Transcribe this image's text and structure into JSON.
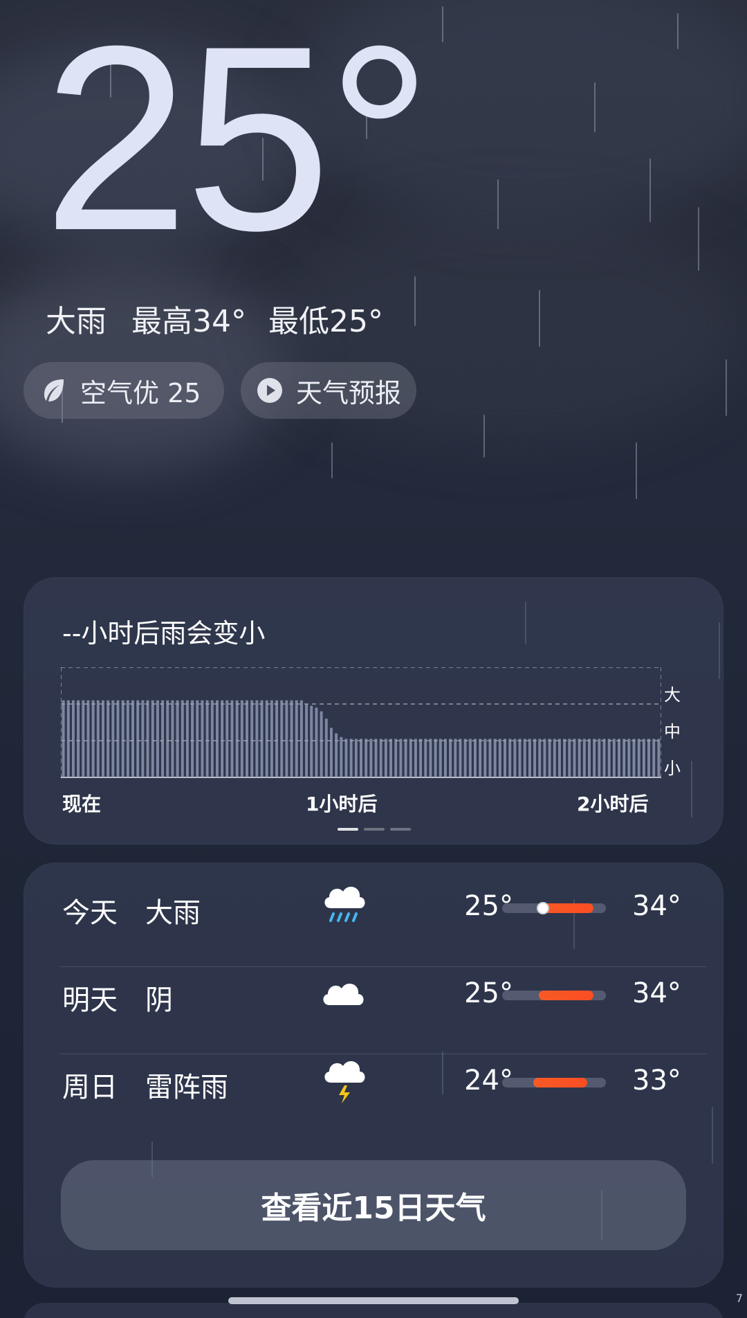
{
  "current": {
    "temperature": "25°",
    "condition": "大雨",
    "high": "最高34°",
    "low": "最低25°"
  },
  "chips": {
    "air": "空气优 25",
    "forecast": "天气预报"
  },
  "rain_card": {
    "title": "--小时后雨会变小",
    "x_labels": [
      "现在",
      "1小时后",
      "2小时后"
    ],
    "levels": [
      "大",
      "中",
      "小"
    ],
    "page_count": 3,
    "active_page": 1
  },
  "chart_data": {
    "type": "bar",
    "title": "--小时后雨会变小",
    "x_tick_labels": [
      "现在",
      "1小时后",
      "2小时后"
    ],
    "y_tick_labels": [
      "小",
      "中",
      "大"
    ],
    "ylim": [
      0,
      3
    ],
    "values": [
      2.1,
      2.1,
      2.1,
      2.1,
      2.1,
      2.1,
      2.1,
      2.1,
      2.1,
      2.1,
      2.1,
      2.1,
      2.1,
      2.1,
      2.1,
      2.1,
      2.1,
      2.1,
      2.1,
      2.1,
      2.1,
      2.1,
      2.1,
      2.1,
      2.1,
      2.1,
      2.1,
      2.1,
      2.1,
      2.1,
      2.1,
      2.1,
      2.1,
      2.1,
      2.1,
      2.1,
      2.1,
      2.1,
      2.1,
      2.1,
      2.1,
      2.1,
      2.1,
      2.1,
      2.1,
      2.1,
      2.1,
      2.1,
      2.1,
      2.0,
      1.95,
      1.9,
      1.8,
      1.6,
      1.35,
      1.2,
      1.1,
      1.05,
      1.05,
      1.05,
      1.05,
      1.05,
      1.05,
      1.05,
      1.05,
      1.05,
      1.05,
      1.05,
      1.05,
      1.05,
      1.05,
      1.05,
      1.05,
      1.05,
      1.05,
      1.05,
      1.05,
      1.05,
      1.05,
      1.05,
      1.05,
      1.05,
      1.05,
      1.05,
      1.05,
      1.05,
      1.05,
      1.05,
      1.05,
      1.05,
      1.05,
      1.05,
      1.05,
      1.05,
      1.05,
      1.05,
      1.05,
      1.05,
      1.05,
      1.05,
      1.05,
      1.05,
      1.05,
      1.05,
      1.05,
      1.05,
      1.05,
      1.05,
      1.05,
      1.05,
      1.05,
      1.05,
      1.05,
      1.05,
      1.05,
      1.05,
      1.05,
      1.05,
      1.05,
      1.05,
      1.05
    ],
    "grid": true,
    "bar_color": "#9aa3bd"
  },
  "daily": [
    {
      "day": "今天",
      "condition": "大雨",
      "icon": "heavy-rain-icon",
      "low": "25°",
      "high": "34°",
      "range_start": 0.35,
      "range_end": 0.88,
      "marker": 0.38
    },
    {
      "day": "明天",
      "condition": "阴",
      "icon": "cloudy-icon",
      "low": "25°",
      "high": "34°",
      "range_start": 0.35,
      "range_end": 0.88,
      "marker": null
    },
    {
      "day": "周日",
      "condition": "雷阵雨",
      "icon": "thunderstorm-icon",
      "low": "24°",
      "high": "33°",
      "range_start": 0.3,
      "range_end": 0.82,
      "marker": null
    }
  ],
  "fifteen_day_button": "查看近15日天气",
  "corner_text": "7",
  "colors": {
    "accent": "#f65a26",
    "background": "#1c2334",
    "card": "#3c445c",
    "temperature_text": "#dfe3f6"
  }
}
